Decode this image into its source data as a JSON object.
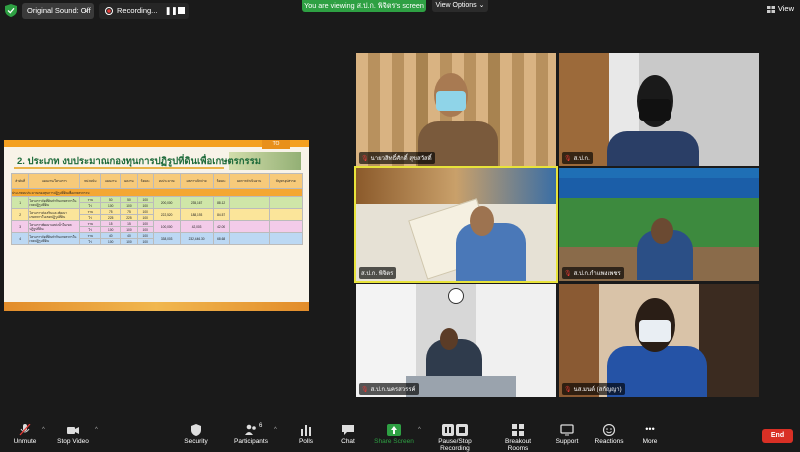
{
  "topbar": {
    "original_sound": "Original Sound: Off",
    "recording": "Recording...",
    "viewing_banner": "You are viewing ส.ป.ก. พิจิตร's screen",
    "view_options": "View Options",
    "view": "View"
  },
  "slide": {
    "tab": "TO",
    "title": "2. ประเภท งบประมาณกองทุนการปฏิรูปที่ดินเพื่อเกษตรกรรม",
    "header": [
      "ลำดับที่",
      "แผนงาน/โครงการ",
      "หน่วยนับ",
      "แผนงาน",
      "ผลงาน",
      "ร้อยละ",
      "งบประมาณ",
      "ผลการเบิกจ่าย",
      "ร้อยละ",
      "ผลการดำเนินงาน",
      "ปัญหาอุปสรรค"
    ],
    "section": "ประเภทงบประมาณกองทุนการปฏิรูปที่ดินเพื่อเกษตรกรรม",
    "rows": [
      {
        "no": "1",
        "name": "โครงการจัดที่ดินทำกินเกษตรกรในเขตปฏิรูปที่ดิน",
        "unit1": "ราย",
        "unit2": "ไร่",
        "p1": "50",
        "p2": "100",
        "r1": "50",
        "r2": "100",
        "pct1": "100",
        "pct2": "100",
        "budget": "200,000",
        "spent": "235,167",
        "spct": "88.12"
      },
      {
        "no": "2",
        "name": "โครงการส่งเสริมและพัฒนาเกษตรกรในเขตปฏิรูปที่ดิน",
        "unit1": "ราย",
        "unit2": "ไร่",
        "p1": "75",
        "p2": "225",
        "r1": "75",
        "r2": "225",
        "pct1": "100",
        "pct2": "100",
        "budget": "222,520",
        "spent": "188,193",
        "spct": "84.57"
      },
      {
        "no": "3",
        "name": "โครงการพัฒนาแหล่งน้ำในเขตปฏิรูปที่ดิน",
        "unit1": "ราย",
        "unit2": "ไร่",
        "p1": "15",
        "p2": "100",
        "r1": "15",
        "r2": "100",
        "pct1": "100",
        "pct2": "100",
        "budget": "100,000",
        "spent": "42,003",
        "spct": "42.00"
      },
      {
        "no": "4",
        "name": "โครงการจัดที่ดินทำกินเกษตรกรในเขตปฏิรูปที่ดิน",
        "unit1": "ราย",
        "unit2": "ไร่",
        "p1": "40",
        "p2": "100",
        "r1": "40",
        "r2": "100",
        "pct1": "100",
        "pct2": "100",
        "budget": "338,003",
        "spent": "232,446.30",
        "spct": "68.68"
      }
    ]
  },
  "tiles": [
    {
      "name": "นายวสิทธิ์ศักดิ์ สุขสวัสดิ์"
    },
    {
      "name": "ส.ป.ก."
    },
    {
      "name": "ส.ป.ก. พิจิตร"
    },
    {
      "name": "ส.ป.ก.กำแพงเพชร"
    },
    {
      "name": "ส.ป.ก.นครสวรรค์"
    },
    {
      "name": "นส.มนต์ (สกัญญา)"
    }
  ],
  "toolbar": {
    "unmute": "Unmute",
    "stop_video": "Stop Video",
    "security": "Security",
    "participants": "Participants",
    "participants_count": "6",
    "polls": "Polls",
    "chat": "Chat",
    "share_screen": "Share Screen",
    "pause_recording": "Pause/Stop Recording",
    "breakout": "Breakout Rooms",
    "support": "Support",
    "reactions": "Reactions",
    "more": "More",
    "end": "End"
  },
  "colors": {
    "accent_green": "#2ea043",
    "end_red": "#d93025",
    "active_speaker": "#e8e33a"
  }
}
